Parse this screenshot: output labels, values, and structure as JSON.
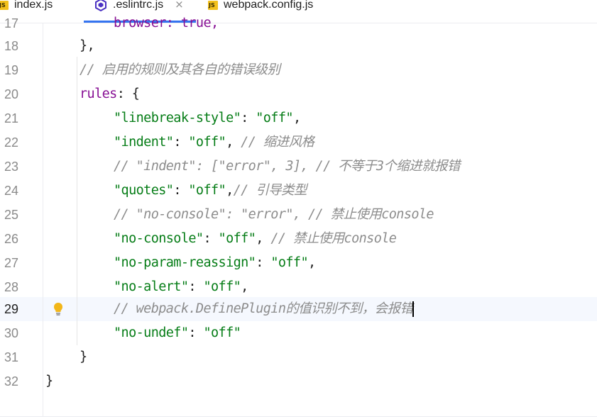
{
  "tabs": [
    {
      "label": "index.js",
      "icon": "js-file-icon",
      "badge": "JS"
    },
    {
      "label": ".eslintrc.js",
      "icon": "eslint-icon",
      "active": true,
      "close": "×"
    },
    {
      "label": "webpack.config.js",
      "icon": "js-file-icon",
      "badge": "JS"
    }
  ],
  "editor": {
    "current_line": 29,
    "lines": [
      {
        "num": "17",
        "text": "browser: true,"
      },
      {
        "num": "18",
        "text": "},"
      },
      {
        "num": "19",
        "comment": "// 启用的规则及其各自的错误级别"
      },
      {
        "num": "20",
        "key": "rules",
        "rest": ": {"
      },
      {
        "num": "21",
        "str": "\"linebreak-style\"",
        "sep": ": ",
        "val": "\"off\"",
        "tail": ","
      },
      {
        "num": "22",
        "str": "\"indent\"",
        "sep": ": ",
        "val": "\"off\"",
        "tail": ", ",
        "comment": "// 缩进风格"
      },
      {
        "num": "23",
        "comment": "// \"indent\": [\"error\", 3], // 不等于3个缩进就报错"
      },
      {
        "num": "24",
        "str": "\"quotes\"",
        "sep": ": ",
        "val": "\"off\"",
        "tail": ",",
        "comment": "// 引导类型"
      },
      {
        "num": "25",
        "comment": "// \"no-console\": \"error\", // 禁止使用console"
      },
      {
        "num": "26",
        "str": "\"no-console\"",
        "sep": ": ",
        "val": "\"off\"",
        "tail": ", ",
        "comment": "// 禁止使用console"
      },
      {
        "num": "27",
        "str": "\"no-param-reassign\"",
        "sep": ": ",
        "val": "\"off\"",
        "tail": ","
      },
      {
        "num": "28",
        "str": "\"no-alert\"",
        "sep": ": ",
        "val": "\"off\"",
        "tail": ","
      },
      {
        "num": "29",
        "comment": "// webpack.DefinePlugin的值识别不到，会报错"
      },
      {
        "num": "30",
        "str": "\"no-undef\"",
        "sep": ": ",
        "val": "\"off\""
      },
      {
        "num": "31",
        "text": "}"
      },
      {
        "num": "32",
        "text": "}"
      }
    ]
  },
  "colors": {
    "string": "#067d17",
    "comment": "#8c8c8c",
    "key": "#871094",
    "accent": "#3574f0",
    "bulb": "#f2b619"
  }
}
